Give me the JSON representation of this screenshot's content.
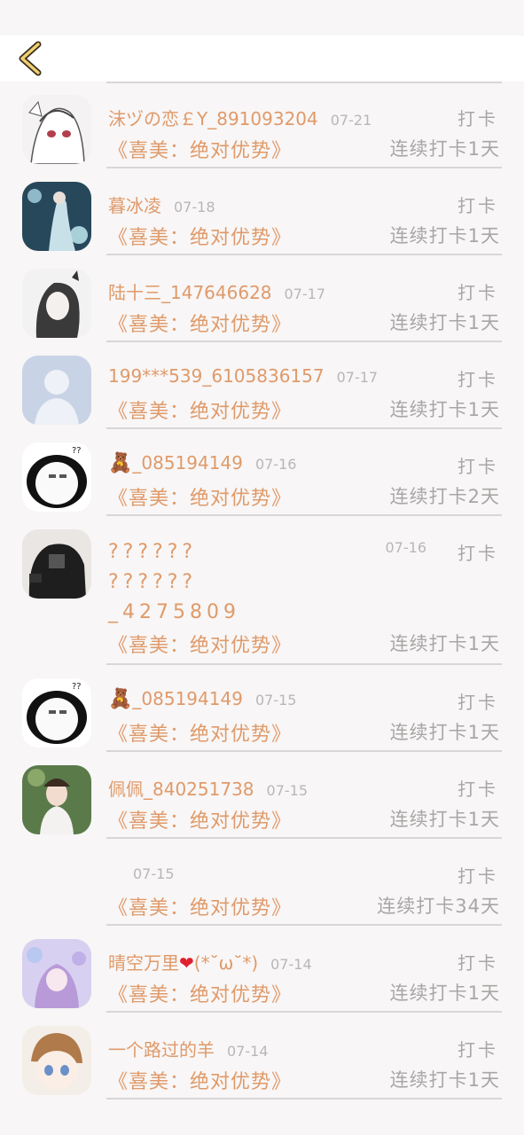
{
  "header": {
    "back_icon": "chevron-left-icon"
  },
  "rows": [
    {
      "name": "沫ヅの恋￡Y_891093204",
      "date": "07-21",
      "action": "打卡",
      "book": "《喜美：绝对优势》",
      "streak": "连续打卡1天",
      "avatar": "anime-girl-white"
    },
    {
      "name": "暮冰凌",
      "date": "07-18",
      "action": "打卡",
      "book": "《喜美：绝对优势》",
      "streak": "连续打卡1天",
      "avatar": "anime-blue"
    },
    {
      "name": "陆十三_147646628",
      "date": "07-17",
      "action": "打卡",
      "book": "《喜美：绝对优势》",
      "streak": "连续打卡1天",
      "avatar": "anime-girl-dark"
    },
    {
      "name": "199***539_6105836157",
      "date": "07-17",
      "action": "打卡",
      "book": "《喜美：绝对优势》",
      "streak": "连续打卡1天",
      "avatar": "default-user"
    },
    {
      "name": "_085194149",
      "date": "07-16",
      "action": "打卡",
      "book": "《喜美：绝对优势》",
      "streak": "连续打卡2天",
      "avatar": "panda-meme"
    },
    {
      "name_lines": [
        "??????",
        "??????",
        "_4275809"
      ],
      "date": "07-16",
      "action": "打卡",
      "book": "《喜美：绝对优势》",
      "streak": "连续打卡1天",
      "avatar": "person-black-shirt"
    },
    {
      "name": "_085194149",
      "date": "07-15",
      "action": "打卡",
      "book": "《喜美：绝对优势》",
      "streak": "连续打卡1天",
      "avatar": "panda-meme"
    },
    {
      "name": "佩佩_840251738",
      "date": "07-15",
      "action": "打卡",
      "book": "《喜美：绝对优势》",
      "streak": "连续打卡1天",
      "avatar": "girl-flowers"
    },
    {
      "name": "",
      "date": "07-15",
      "action": "打卡",
      "book": "《喜美：绝对优势》",
      "streak": "连续打卡34天",
      "avatar": ""
    },
    {
      "name_pre": "晴空万里",
      "name_post": "(*˘ω˘*)",
      "date": "07-14",
      "action": "打卡",
      "book": "《喜美：绝对优势》",
      "streak": "连续打卡1天",
      "avatar": "anime-purple"
    },
    {
      "name": "一个路过的羊",
      "date": "07-14",
      "action": "打卡",
      "book": "《喜美：绝对优势》",
      "streak": "连续打卡1天",
      "avatar": "anime-boy"
    }
  ]
}
